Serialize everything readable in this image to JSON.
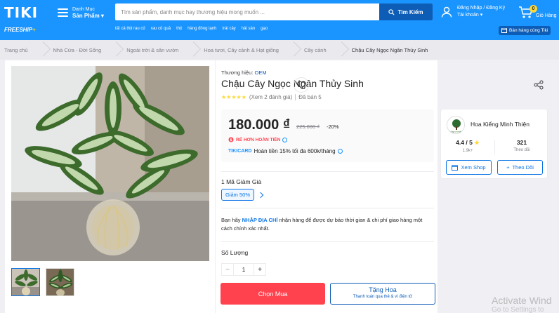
{
  "header": {
    "logo": "TIKI",
    "freeship": "FREESHIP",
    "freeship_plus": "+",
    "menu_label_top": "Danh Mục",
    "menu_label_bottom": "Sản Phẩm",
    "search_placeholder": "Tìm sản phẩm, danh mục hay thương hiệu mong muốn ...",
    "search_button": "Tìm Kiếm",
    "quick_links": [
      "tất cả thịt rau củ",
      "rau củ quả",
      "thịt",
      "hàng đông lạnh",
      "trái cây",
      "hải sản",
      "gạo"
    ],
    "account_top": "Đăng Nhập / Đăng Ký",
    "account_bottom": "Tài khoản",
    "cart_count": "0",
    "cart_label": "Giỏ Hàng",
    "seller_label": "Bán hàng cùng Tiki"
  },
  "breadcrumb": [
    "Trang chủ",
    "Nhà Cửa - Đời Sống",
    "Ngoài trời & sân vườn",
    "Hoa tươi, Cây cảnh & Hạt giống",
    "Cây cảnh",
    "Chậu Cây Ngọc Ngân Thủy Sinh"
  ],
  "product": {
    "brand_label": "Thương hiệu:",
    "brand": "OEM",
    "title": "Chậu Cây Ngọc Ngân Thủy Sinh",
    "stars": "★★★★★",
    "rating_value": 5,
    "reviews": "(Xem 2 đánh giá)",
    "sold": "Đã bán 5",
    "price": "180.000 ₫",
    "old_price": "225.000 ₫",
    "discount": "-20%",
    "refund_tag": "RẺ HƠN HOÀN TIỀN",
    "tikicard_brand": "TIKICARD",
    "tikicard_text": "Hoàn tiền 15% tối đa 600k/tháng",
    "coupon_title": "1 Mã Giảm Giá",
    "coupon_tag": "Giảm 50%",
    "ship_note_pre": "Bạn hãy ",
    "ship_note_hl": "NHẬP ĐỊA CHỈ",
    "ship_note_post": " nhận hàng để được dự báo thời gian & chi phí giao hàng một cách chính xác nhất.",
    "qty_label": "Số Lượng",
    "qty_minus": "−",
    "qty_value": "1",
    "qty_plus": "+",
    "buy_label": "Chọn Mua",
    "gift_label": "Tặng Hoa",
    "gift_sub": "Thanh toán qua thẻ & ví điện tử"
  },
  "seller": {
    "logo_text": "VĨNH THIỆN",
    "name": "Hoa Kiểng Minh Thiện",
    "rating": "4.4 / 5",
    "rating_star": "★",
    "rating_label": "1.9k+",
    "followers": "321",
    "followers_label": "Theo dõi",
    "view_shop": "Xem Shop",
    "follow": "Theo Dõi"
  },
  "watermark": {
    "line1": "Activate Wind",
    "line2": "Go to Settings to"
  },
  "colors": {
    "brand_blue": "#1a94ff",
    "dark_blue": "#0d5cb6",
    "buy_red": "#ff424e",
    "star_yellow": "#fdd836"
  },
  "icons": [
    "hamburger-icon",
    "search-icon",
    "user-icon",
    "cart-icon",
    "heart-icon",
    "share-icon",
    "chevron-right-icon",
    "info-icon",
    "shop-icon",
    "plus-icon"
  ]
}
